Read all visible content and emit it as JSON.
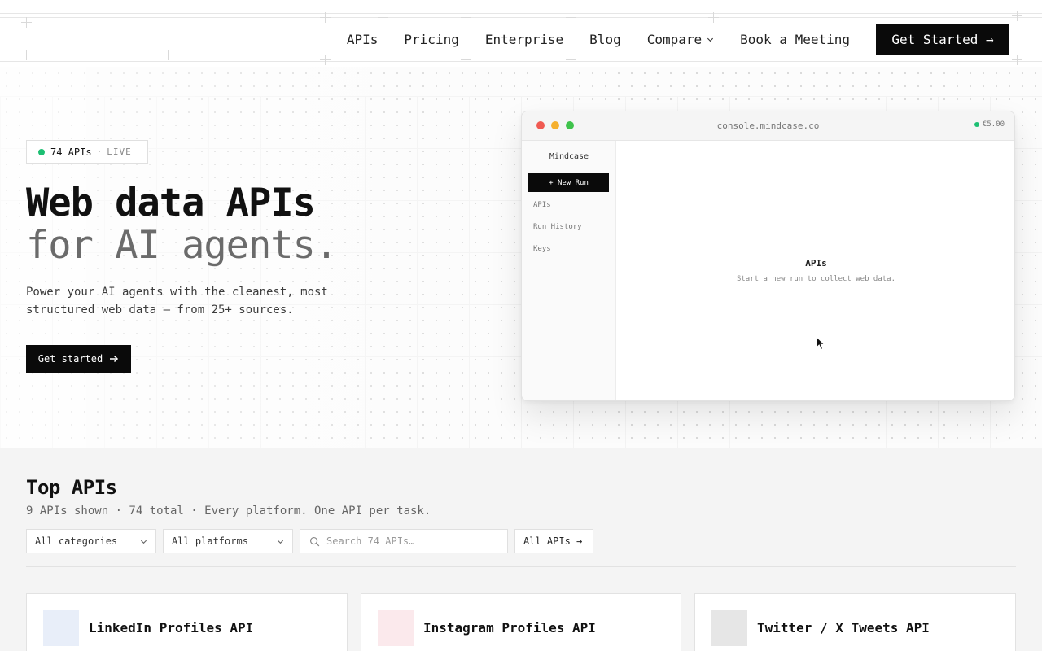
{
  "nav": {
    "links": [
      "APIs",
      "Pricing",
      "Enterprise",
      "Blog",
      "Compare",
      "Book a Meeting"
    ],
    "cta": "Get Started →"
  },
  "hero": {
    "badge_count": "74 APIs",
    "badge_sep": "·",
    "badge_status": "LIVE",
    "title_line1": "Web data APIs",
    "title_line2": "for AI agents.",
    "subtitle": "Power your AI agents with the cleanest, most structured web data — from 25+ sources.",
    "cta": "Get started"
  },
  "console": {
    "url": "console.mindcase.co",
    "credit": "€5.00",
    "brand": "Mindcase",
    "new_run": "+ New Run",
    "sidebar_items": [
      "APIs",
      "Run History",
      "Keys"
    ],
    "panel_title": "APIs",
    "panel_desc": "Start a new run to collect web data."
  },
  "top_apis": {
    "title": "Top APIs",
    "meta": "9 APIs shown · 74 total · Every platform. One API per task.",
    "category_filter": "All categories",
    "platform_filter": "All platforms",
    "search_placeholder": "Search 74 APIs…",
    "all_apis": "All APIs →",
    "cards": [
      {
        "title": "LinkedIn Profiles API",
        "icon_color": "#e8eef9"
      },
      {
        "title": "Instagram Profiles API",
        "icon_color": "#fbe9ec"
      },
      {
        "title": "Twitter / X Tweets API",
        "icon_color": "#e6e6e6"
      }
    ]
  },
  "colors": {
    "accent": "#0a0a0a",
    "live": "#1dbf73"
  }
}
